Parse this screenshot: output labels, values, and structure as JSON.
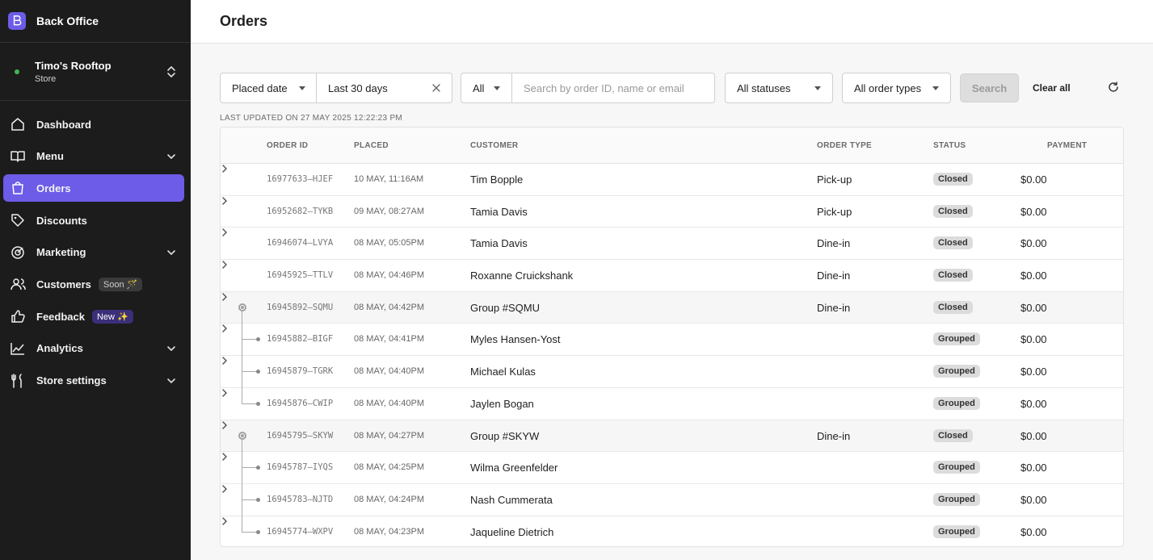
{
  "app": {
    "title": "Back Office"
  },
  "store": {
    "name": "Timo's Rooftop",
    "type": "Store"
  },
  "nav": [
    {
      "label": "Dashboard",
      "icon": "home-icon",
      "chevron": false,
      "active": false,
      "badge": ""
    },
    {
      "label": "Menu",
      "icon": "book-icon",
      "chevron": true,
      "active": false,
      "badge": ""
    },
    {
      "label": "Orders",
      "icon": "shopping-bag-icon",
      "chevron": false,
      "active": true,
      "badge": ""
    },
    {
      "label": "Discounts",
      "icon": "tag-icon",
      "chevron": false,
      "active": false,
      "badge": ""
    },
    {
      "label": "Marketing",
      "icon": "target-icon",
      "chevron": true,
      "active": false,
      "badge": ""
    },
    {
      "label": "Customers",
      "icon": "users-icon",
      "chevron": false,
      "active": false,
      "badge": "Soon 🪄"
    },
    {
      "label": "Feedback",
      "icon": "thumbs-up-icon",
      "chevron": false,
      "active": false,
      "badge": "New ✨"
    },
    {
      "label": "Analytics",
      "icon": "chart-icon",
      "chevron": true,
      "active": false,
      "badge": ""
    },
    {
      "label": "Store settings",
      "icon": "tools-icon",
      "chevron": true,
      "active": false,
      "badge": ""
    }
  ],
  "page": {
    "title": "Orders"
  },
  "filters": {
    "date_type": "Placed date",
    "date_range": "Last 30 days",
    "search_field": "All",
    "search_placeholder": "Search by order ID, name or email",
    "search_value": "",
    "status": "All statuses",
    "order_type": "All order types",
    "search_label": "Search",
    "clear_all_label": "Clear all"
  },
  "last_updated": "LAST UPDATED ON 27 MAY 2025 12:22:23 PM",
  "table": {
    "headers": {
      "order_id": "ORDER ID",
      "placed": "PLACED",
      "customer": "CUSTOMER",
      "order_type": "ORDER TYPE",
      "status": "STATUS",
      "payment": "PAYMENT"
    },
    "rows": [
      {
        "order_id": "16977633–HJEF",
        "placed": "10 MAY, 11:16AM",
        "customer": "Tim Bopple",
        "order_type": "Pick-up",
        "status": "Closed",
        "payment": "$0.00",
        "tree": "none"
      },
      {
        "order_id": "16952682–TYKB",
        "placed": "09 MAY, 08:27AM",
        "customer": "Tamia Davis",
        "order_type": "Pick-up",
        "status": "Closed",
        "payment": "$0.00",
        "tree": "none"
      },
      {
        "order_id": "16946074–LVYA",
        "placed": "08 MAY, 05:05PM",
        "customer": "Tamia Davis",
        "order_type": "Dine-in",
        "status": "Closed",
        "payment": "$0.00",
        "tree": "none"
      },
      {
        "order_id": "16945925–TTLV",
        "placed": "08 MAY, 04:46PM",
        "customer": "Roxanne Cruickshank",
        "order_type": "Dine-in",
        "status": "Closed",
        "payment": "$0.00",
        "tree": "none"
      },
      {
        "order_id": "16945892–SQMU",
        "placed": "08 MAY, 04:42PM",
        "customer": "Group #SQMU",
        "order_type": "Dine-in",
        "status": "Closed",
        "payment": "$0.00",
        "tree": "group"
      },
      {
        "order_id": "16945882–BIGF",
        "placed": "08 MAY, 04:41PM",
        "customer": "Myles Hansen-Yost",
        "order_type": "",
        "status": "Grouped",
        "payment": "$0.00",
        "tree": "child"
      },
      {
        "order_id": "16945879–TGRK",
        "placed": "08 MAY, 04:40PM",
        "customer": "Michael Kulas",
        "order_type": "",
        "status": "Grouped",
        "payment": "$0.00",
        "tree": "child"
      },
      {
        "order_id": "16945876–CWIP",
        "placed": "08 MAY, 04:40PM",
        "customer": "Jaylen Bogan",
        "order_type": "",
        "status": "Grouped",
        "payment": "$0.00",
        "tree": "last"
      },
      {
        "order_id": "16945795–SKYW",
        "placed": "08 MAY, 04:27PM",
        "customer": "Group #SKYW",
        "order_type": "Dine-in",
        "status": "Closed",
        "payment": "$0.00",
        "tree": "group"
      },
      {
        "order_id": "16945787–IYQS",
        "placed": "08 MAY, 04:25PM",
        "customer": "Wilma Greenfelder",
        "order_type": "",
        "status": "Grouped",
        "payment": "$0.00",
        "tree": "child"
      },
      {
        "order_id": "16945783–NJTD",
        "placed": "08 MAY, 04:24PM",
        "customer": "Nash Cummerata",
        "order_type": "",
        "status": "Grouped",
        "payment": "$0.00",
        "tree": "child"
      },
      {
        "order_id": "16945774–WXPV",
        "placed": "08 MAY, 04:23PM",
        "customer": "Jaqueline Dietrich",
        "order_type": "",
        "status": "Grouped",
        "payment": "$0.00",
        "tree": "last"
      }
    ]
  },
  "colors": {
    "sidebar_bg": "#1c1c1c",
    "accent": "#6c5ce7",
    "online": "#3fb950"
  }
}
